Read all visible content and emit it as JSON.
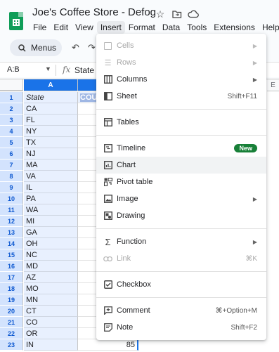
{
  "document": {
    "title": "Joe's Coffee Store - Defog"
  },
  "menubar": [
    "File",
    "Edit",
    "View",
    "Insert",
    "Format",
    "Data",
    "Tools",
    "Extensions",
    "Help"
  ],
  "active_menu": "Insert",
  "toolbar": {
    "search_label": "Menus"
  },
  "formula_bar": {
    "name_box": "A:B",
    "fx_symbol": "fx",
    "content": "State"
  },
  "grid": {
    "columns": [
      "A",
      "E"
    ],
    "header_row": {
      "a": "State",
      "b": "COU"
    },
    "rows": [
      {
        "n": "1",
        "a": "State",
        "b": ""
      },
      {
        "n": "2",
        "a": "CA",
        "b": ""
      },
      {
        "n": "3",
        "a": "FL",
        "b": ""
      },
      {
        "n": "4",
        "a": "NY",
        "b": ""
      },
      {
        "n": "5",
        "a": "TX",
        "b": ""
      },
      {
        "n": "6",
        "a": "NJ",
        "b": ""
      },
      {
        "n": "7",
        "a": "MA",
        "b": ""
      },
      {
        "n": "8",
        "a": "VA",
        "b": ""
      },
      {
        "n": "9",
        "a": "IL",
        "b": ""
      },
      {
        "n": "10",
        "a": "PA",
        "b": ""
      },
      {
        "n": "11",
        "a": "WA",
        "b": ""
      },
      {
        "n": "12",
        "a": "MI",
        "b": ""
      },
      {
        "n": "13",
        "a": "GA",
        "b": ""
      },
      {
        "n": "14",
        "a": "OH",
        "b": ""
      },
      {
        "n": "15",
        "a": "NC",
        "b": ""
      },
      {
        "n": "16",
        "a": "MD",
        "b": ""
      },
      {
        "n": "17",
        "a": "AZ",
        "b": ""
      },
      {
        "n": "18",
        "a": "MO",
        "b": ""
      },
      {
        "n": "19",
        "a": "MN",
        "b": ""
      },
      {
        "n": "20",
        "a": "CT",
        "b": ""
      },
      {
        "n": "21",
        "a": "CO",
        "b": ""
      },
      {
        "n": "22",
        "a": "OR",
        "b": ""
      },
      {
        "n": "23",
        "a": "IN",
        "b": "85"
      }
    ]
  },
  "insert_menu": {
    "cells": "Cells",
    "rows": "Rows",
    "columns": "Columns",
    "sheet": "Sheet",
    "sheet_shortcut": "Shift+F11",
    "tables": "Tables",
    "timeline": "Timeline",
    "timeline_badge": "New",
    "chart": "Chart",
    "pivot_table": "Pivot table",
    "image": "Image",
    "drawing": "Drawing",
    "function": "Function",
    "link": "Link",
    "link_shortcut": "⌘K",
    "checkbox": "Checkbox",
    "comment": "Comment",
    "comment_shortcut": "⌘+Option+M",
    "note": "Note",
    "note_shortcut": "Shift+F2"
  },
  "colors": {
    "accent": "#1a73e8",
    "selection": "#e8f0fe",
    "badge": "#188038",
    "logo": "#0f9d58"
  }
}
